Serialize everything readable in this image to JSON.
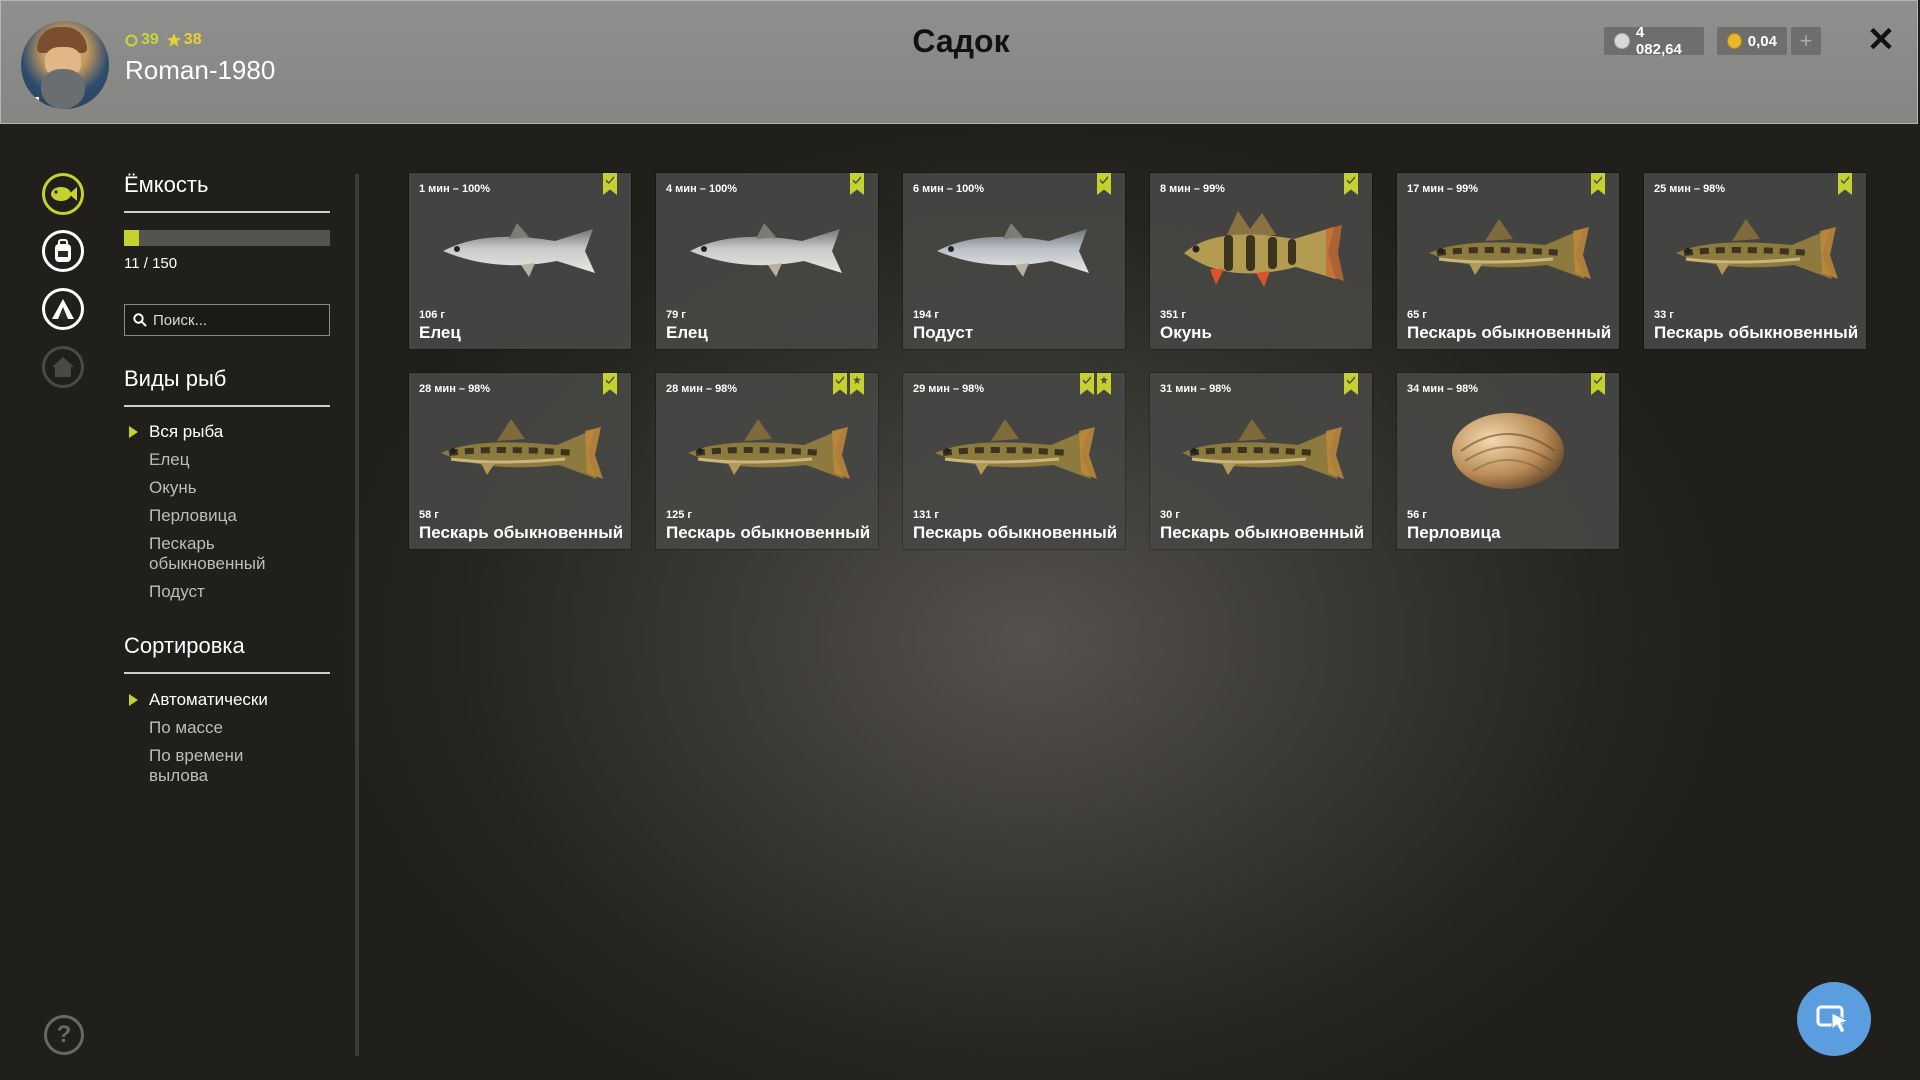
{
  "header": {
    "title": "Садок",
    "username": "Roman-1980",
    "level": "39",
    "stars": "38",
    "silver": "4 082,64",
    "gold": "0,04",
    "add_label": "+",
    "close_label": "✕"
  },
  "sidebar": {
    "capacity_title": "Ёмкость",
    "capacity_text": "11 / 150",
    "capacity_fraction": 0.0733,
    "search_placeholder": "Поиск...",
    "species_title": "Виды рыб",
    "species": [
      "Вся рыба",
      "Елец",
      "Окунь",
      "Перловица",
      "Пескарь обыкновенный",
      "Подуст"
    ],
    "sort_title": "Сортировка",
    "sort_options": [
      "Автоматически",
      "По массе",
      "По времени вылова"
    ],
    "help_label": "?"
  },
  "fish": [
    {
      "time": "1 мин – 100%",
      "weight": "106 г",
      "name": "Елец",
      "kind": "dace",
      "marks": [
        "check"
      ]
    },
    {
      "time": "4 мин – 100%",
      "weight": "79 г",
      "name": "Елец",
      "kind": "dace",
      "marks": [
        "check"
      ]
    },
    {
      "time": "6 мин – 100%",
      "weight": "194 г",
      "name": "Подуст",
      "kind": "nase",
      "marks": [
        "check"
      ]
    },
    {
      "time": "8 мин – 99%",
      "weight": "351 г",
      "name": "Окунь",
      "kind": "perch",
      "marks": [
        "check"
      ]
    },
    {
      "time": "17 мин – 99%",
      "weight": "65 г",
      "name": "Пескарь обыкновенный",
      "kind": "gudgeon",
      "marks": [
        "check"
      ]
    },
    {
      "time": "25 мин – 98%",
      "weight": "33 г",
      "name": "Пескарь обыкновенный",
      "kind": "gudgeon",
      "marks": [
        "check"
      ]
    },
    {
      "time": "28 мин – 98%",
      "weight": "58 г",
      "name": "Пескарь обыкновенный",
      "kind": "gudgeon",
      "marks": [
        "check"
      ]
    },
    {
      "time": "28 мин – 98%",
      "weight": "125 г",
      "name": "Пескарь обыкновенный",
      "kind": "gudgeon",
      "marks": [
        "check",
        "star"
      ]
    },
    {
      "time": "29 мин – 98%",
      "weight": "131 г",
      "name": "Пескарь обыкновенный",
      "kind": "gudgeon",
      "marks": [
        "check",
        "star"
      ]
    },
    {
      "time": "31 мин – 98%",
      "weight": "30 г",
      "name": "Пескарь обыкновенный",
      "kind": "gudgeon",
      "marks": [
        "check"
      ]
    },
    {
      "time": "34 мин – 98%",
      "weight": "56 г",
      "name": "Перловица",
      "kind": "mussel",
      "marks": [
        "check"
      ]
    }
  ],
  "colors": {
    "accent": "#c5d12e",
    "header_bg": "#8c8c8a",
    "card_bg": "#464644",
    "cursor_button": "#5b9ee0"
  }
}
